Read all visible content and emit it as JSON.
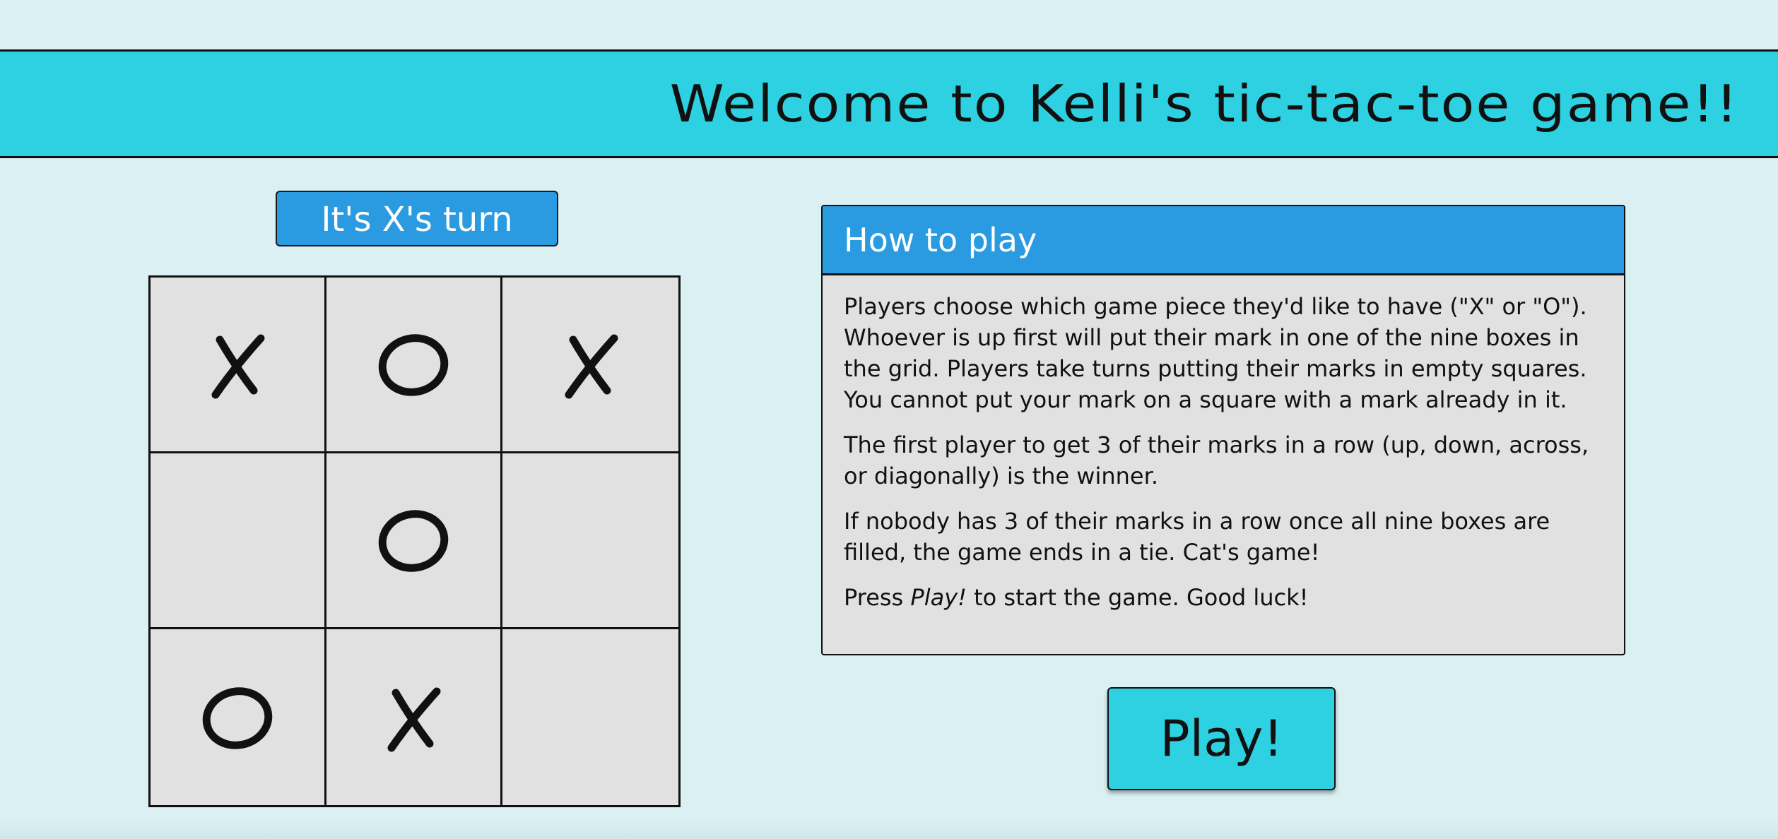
{
  "header": {
    "title": "Welcome to Kelli's tic-tac-toe game!!"
  },
  "status": {
    "turn_text": "It's X's turn"
  },
  "board": {
    "cells": [
      "X",
      "O",
      "X",
      "",
      "O",
      "",
      "O",
      "X",
      ""
    ]
  },
  "rules": {
    "heading": "How to play",
    "paragraphs": [
      "Players choose which game piece they'd like to have (\"X\" or \"O\"). Whoever is up first will put their mark in one of the nine boxes in the grid. Players take turns putting their marks in empty squares. You cannot put your mark on a square with a mark already in it.",
      "The first player to get 3 of their marks in a row (up, down, across, or diagonally) is the winner.",
      "If nobody has 3 of their marks in a row once all nine boxes are filled, the game ends in a tie. Cat's game!"
    ],
    "last": {
      "prefix": "Press ",
      "emphasis": "Play!",
      "suffix": " to start the game. Good luck!"
    }
  },
  "play_button": {
    "label": "Play!"
  },
  "colors": {
    "background": "#daf0f3",
    "header": "#2dd1e1",
    "accent_blue": "#2a9be1",
    "cell": "#e1e1e1"
  }
}
